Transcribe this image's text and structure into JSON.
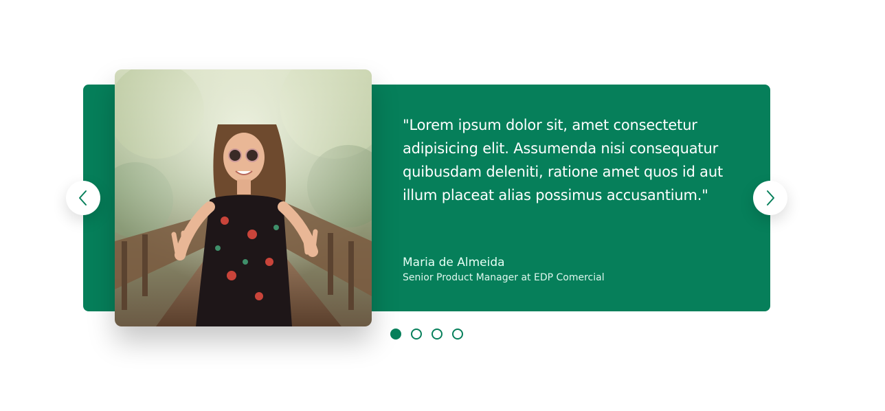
{
  "colors": {
    "accent": "#067f5a",
    "text_on_accent": "#ffffff"
  },
  "testimonial": {
    "quote": "\"Lorem ipsum dolor sit, amet consectetur adipisicing elit. Assumenda nisi consequatur quibusdam deleniti, ratione amet quos id aut illum placeat alias possimus accusantium.\"",
    "author_name": "Maria de Almeida",
    "author_role": "Senior Product Manager at EDP Comercial"
  },
  "navigation": {
    "prev_icon": "chevron-left-icon",
    "next_icon": "chevron-right-icon"
  },
  "pagination": {
    "total": 4,
    "active_index": 0
  }
}
